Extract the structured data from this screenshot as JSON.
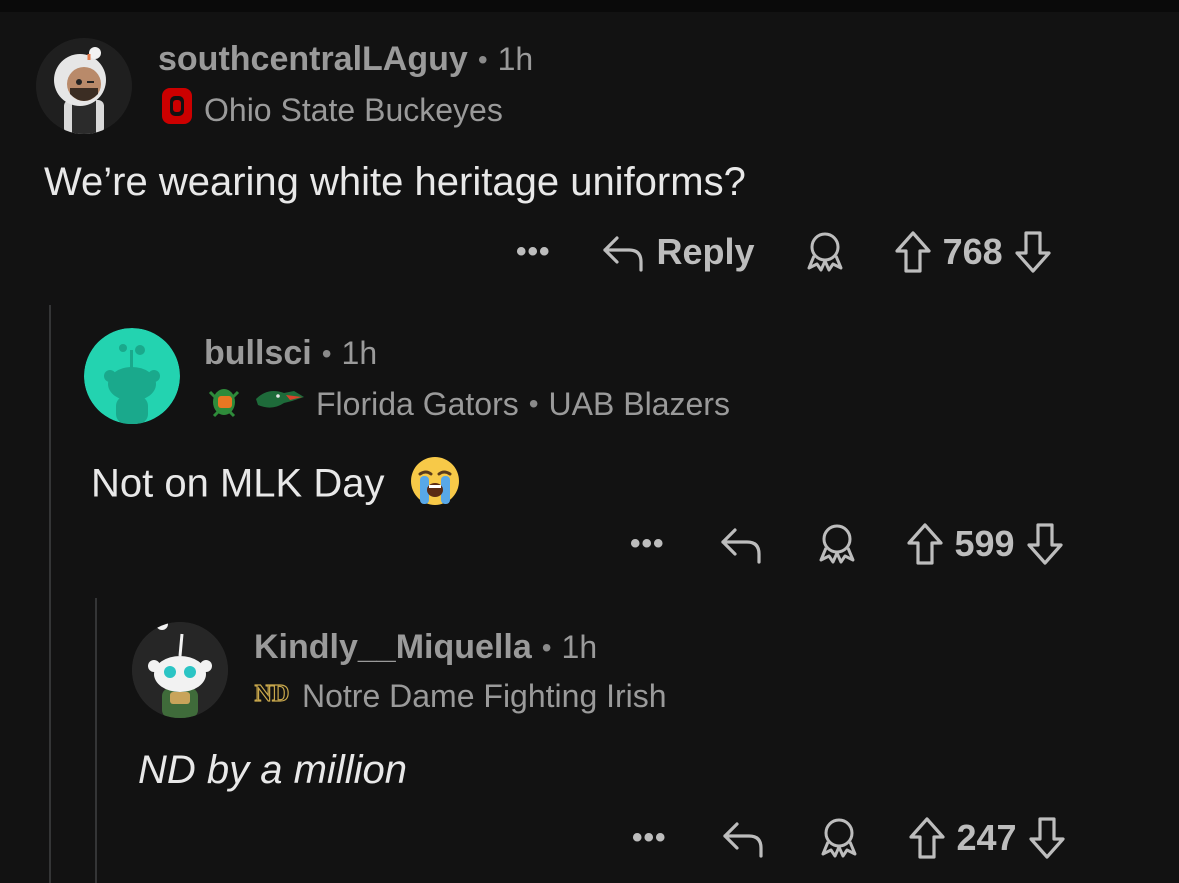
{
  "comments": [
    {
      "username": "southcentralLAguy",
      "separator": "•",
      "time": "1h",
      "flair": "Ohio State Buckeyes",
      "body": "We’re wearing white heritage uniforms?",
      "more": "•••",
      "reply_label": "Reply",
      "score": "768"
    },
    {
      "username": "bullsci",
      "separator": "•",
      "time": "1h",
      "flair": "Florida Gators",
      "flair_separator": "•",
      "flair2": "UAB Blazers",
      "body": "Not on MLK Day",
      "more": "•••",
      "score": "599"
    },
    {
      "username": "Kindly__Miquella",
      "separator": "•",
      "time": "1h",
      "flair": "Notre Dame Fighting Irish",
      "body": "ND by a million",
      "more": "•••",
      "score": "247"
    }
  ],
  "flair_badges": {
    "ohio_state": "O",
    "notre_dame": "ND"
  },
  "colors": {
    "background": "#121212",
    "thread_line": "#343536",
    "avatar_teal": "#23d3b0",
    "ohio_red": "#cc0000"
  }
}
